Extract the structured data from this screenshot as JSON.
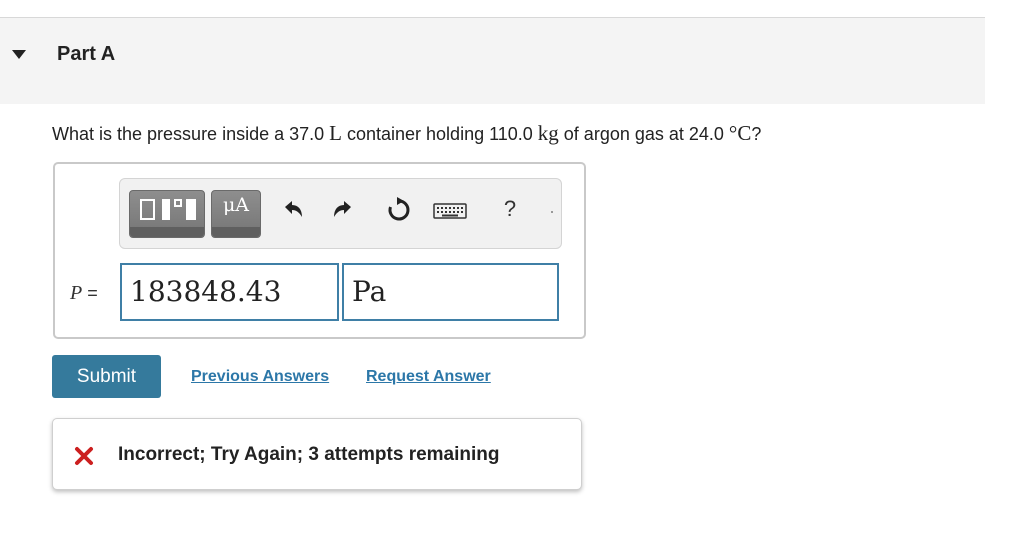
{
  "part": {
    "title": "Part A"
  },
  "question": {
    "before_volume": "What is the pressure inside a 37.0 ",
    "volume_unit": "L",
    "mid1": " container holding 110.0 ",
    "mass_unit": "kg",
    "mid2": " of argon gas at 24.0 ",
    "temp_unit": "°C",
    "end": "?"
  },
  "toolbar": {
    "units_label": "μA",
    "help_label": "?",
    "icons": [
      "templates-icon",
      "units-icon",
      "undo-icon",
      "redo-icon",
      "reset-icon",
      "keyboard-icon",
      "help-icon"
    ]
  },
  "answer": {
    "variable": "P",
    "equals": " =",
    "value": "183848.43",
    "unit": "Pa"
  },
  "actions": {
    "submit_label": "Submit",
    "previous_answers_label": "Previous Answers",
    "request_answer_label": "Request Answer"
  },
  "feedback": {
    "message": "Incorrect; Try Again; 3 attempts remaining",
    "status_color": "#cc1f1f"
  },
  "colors": {
    "accent": "#357a9c",
    "link": "#2c77a8",
    "field_border": "#3f7fa6"
  }
}
